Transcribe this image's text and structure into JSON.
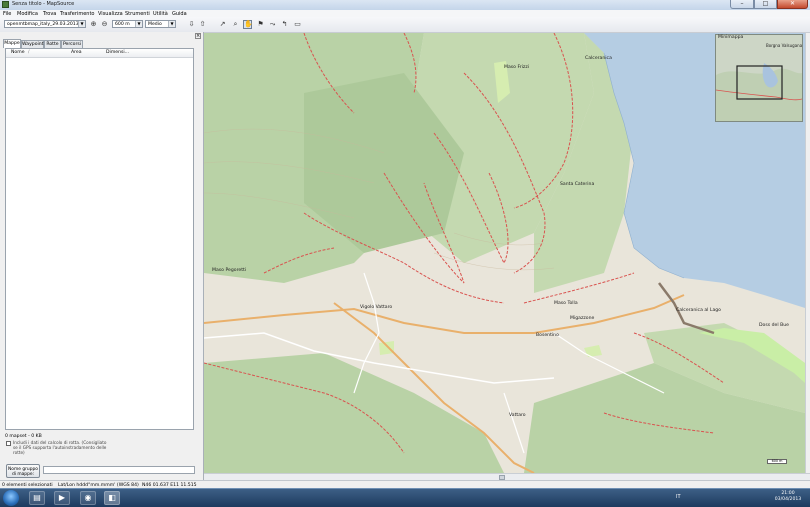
{
  "window": {
    "title": "Senza titolo - MapSource"
  },
  "menu": [
    "File",
    "Modifica",
    "Trova",
    "Trasferimento",
    "Visualizza",
    "Strumenti",
    "Utilità",
    "Guida"
  ],
  "toolbar": {
    "product_combo": "openmtbmap_italy_29.03.2013",
    "zoom_combo": "600 m",
    "detail_combo": "Medio"
  },
  "left_panel": {
    "tabs": [
      "Mappe",
      "Waypoint",
      "Rotte",
      "Percorsi"
    ],
    "active_tab": "Mappe",
    "columns": [
      "Nome",
      "Area",
      "Dimensi..."
    ],
    "mapset_count": "0 mapset - 0 KB",
    "include_label_lines": [
      "Includi i dati del calcolo di rotta. (Consigliato",
      "se il GPS supporta l'autoinstradamento delle",
      "rotte)"
    ],
    "mapset_button_lines": [
      "Nome gruppo",
      "di mappe:"
    ]
  },
  "map": {
    "minimap_title": "Minimappa",
    "minimap_place": "Borgna Valsugana",
    "places": [
      {
        "name": "Maso Frizzi"
      },
      {
        "name": "Calceranica"
      },
      {
        "name": "Santa Caterina"
      },
      {
        "name": "Maso Pegoretti"
      },
      {
        "name": "Maso Tolla"
      },
      {
        "name": "Vigolo Vattaro"
      },
      {
        "name": "Migazzone"
      },
      {
        "name": "Doss del Bue"
      },
      {
        "name": "Calceranica al Lago"
      },
      {
        "name": "Bosentino"
      },
      {
        "name": "Vattaro"
      }
    ],
    "scale": "600 m"
  },
  "status": {
    "selected": "0 elementi selezionati",
    "format": "Lat/Lon hddd°mm.mmm' (WGS 84)",
    "coords": "N46 01.637 E11 11.515"
  },
  "taskbar": {
    "lang": "IT",
    "time": "21:00",
    "date": "03/04/2013"
  },
  "colors": {
    "lake": "#b5cde3",
    "forest": "#b9d2a6",
    "meadow": "#d2e3bc",
    "trail": "#d9534f"
  }
}
